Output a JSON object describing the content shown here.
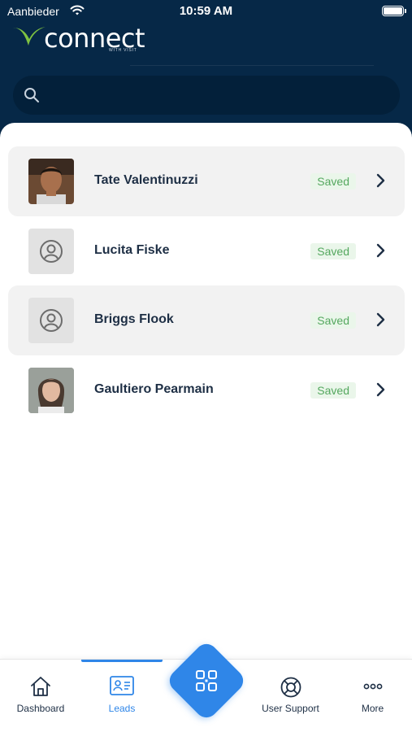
{
  "status_bar": {
    "carrier": "Aanbieder",
    "time": "10:59 AM"
  },
  "brand": {
    "name": "connect",
    "tagline": "WITH VISIT",
    "accent_color": "#7fc241"
  },
  "search": {
    "placeholder": "",
    "value": ""
  },
  "leads": [
    {
      "name": "Tate Valentinuzzi",
      "status": "Saved",
      "avatar": "photo"
    },
    {
      "name": "Lucita Fiske",
      "status": "Saved",
      "avatar": "placeholder"
    },
    {
      "name": "Briggs Flook",
      "status": "Saved",
      "avatar": "placeholder"
    },
    {
      "name": "Gaultiero Pearmain",
      "status": "Saved",
      "avatar": "photo"
    }
  ],
  "tabbar": {
    "tabs": [
      {
        "label": "Dashboard",
        "icon": "home-icon",
        "active": false
      },
      {
        "label": "Leads",
        "icon": "contact-card-icon",
        "active": true
      },
      {
        "label": "",
        "icon": "qr-scan-icon",
        "active": false
      },
      {
        "label": "User Support",
        "icon": "lifebuoy-icon",
        "active": false
      },
      {
        "label": "More",
        "icon": "ellipsis-icon",
        "active": false
      }
    ]
  },
  "colors": {
    "header_bg": "#062847",
    "primary": "#2f86e8",
    "saved_text": "#55a85f",
    "saved_bg": "#eaf6ea",
    "text_dark": "#1e2f45"
  }
}
